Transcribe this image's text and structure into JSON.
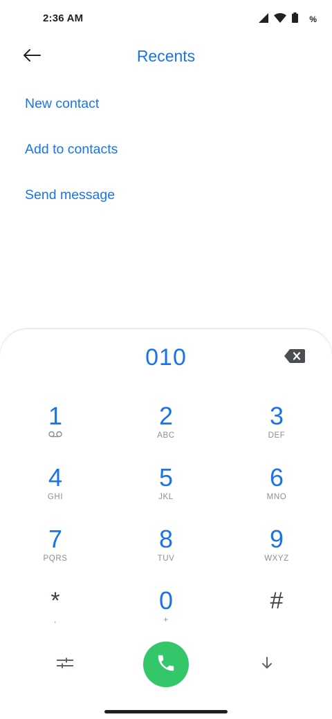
{
  "status_bar": {
    "time": "2:36 AM",
    "battery_percent": "%",
    "icons": [
      "signal-icon",
      "wifi-icon",
      "battery-icon"
    ]
  },
  "header": {
    "title": "Recents",
    "back_icon": "arrow-left-icon"
  },
  "actions": {
    "new_contact": "New contact",
    "add_to_contacts": "Add to contacts",
    "send_message": "Send message"
  },
  "dialpad": {
    "number": "010",
    "backspace_icon": "backspace-icon",
    "keys": [
      {
        "digit": "1",
        "letters": "",
        "sub_icon": "voicemail-icon"
      },
      {
        "digit": "2",
        "letters": "ABC"
      },
      {
        "digit": "3",
        "letters": "DEF"
      },
      {
        "digit": "4",
        "letters": "GHI"
      },
      {
        "digit": "5",
        "letters": "JKL"
      },
      {
        "digit": "6",
        "letters": "MNO"
      },
      {
        "digit": "7",
        "letters": "PQRS"
      },
      {
        "digit": "8",
        "letters": "TUV"
      },
      {
        "digit": "9",
        "letters": "WXYZ"
      },
      {
        "digit": "*",
        "letters": ","
      },
      {
        "digit": "0",
        "letters": "+"
      },
      {
        "digit": "#",
        "letters": ""
      }
    ],
    "bottom": {
      "options_icon": "sliders-icon",
      "call_icon": "phone-icon",
      "collapse_icon": "arrow-down-icon"
    }
  },
  "colors": {
    "accent": "#1a73e8",
    "call": "#34c76a",
    "text_dark": "#202124",
    "text_muted": "#8a8d91"
  }
}
